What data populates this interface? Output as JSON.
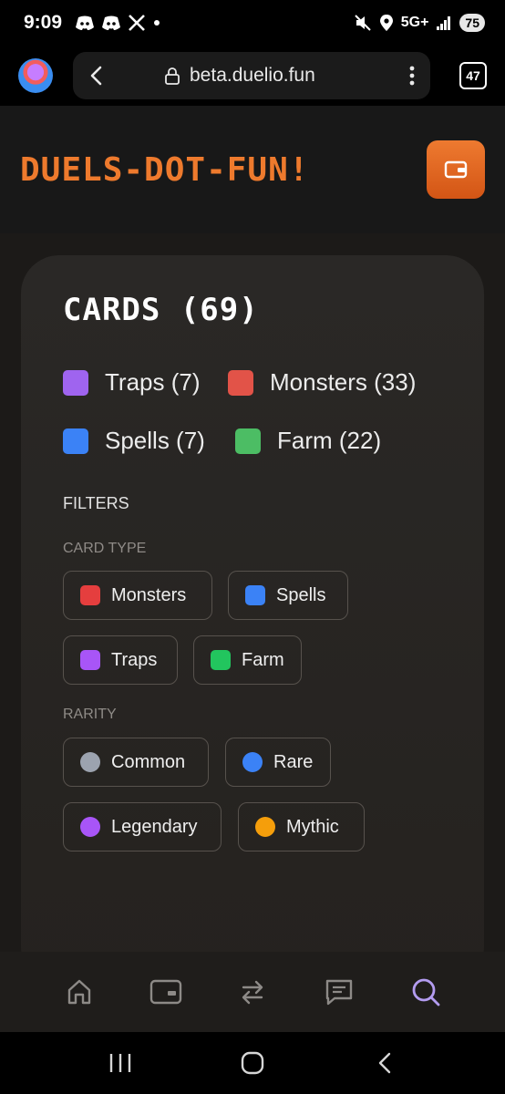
{
  "status_bar": {
    "time": "9:09",
    "network": "5G+",
    "battery": "75",
    "icons": [
      "discord-icon",
      "discord-icon",
      "x-icon",
      "dot-icon",
      "mute-icon",
      "location-icon",
      "signal-icon"
    ]
  },
  "browser": {
    "url": "beta.duelio.fun",
    "tab_count": "47"
  },
  "header": {
    "site_title": "DUELS-DOT-FUN!",
    "wallet_icon": "wallet-icon",
    "accent_color": "#e3631f"
  },
  "cards": {
    "title": "CARDS (69)",
    "counts": [
      {
        "label": "Traps (7)",
        "color": "#9f64ef"
      },
      {
        "label": "Monsters (33)",
        "color": "#e25348"
      },
      {
        "label": "Spells (7)",
        "color": "#3b82f6"
      },
      {
        "label": "Farm (22)",
        "color": "#4cbd64"
      }
    ]
  },
  "filters": {
    "heading": "FILTERS",
    "card_type_label": "CARD TYPE",
    "card_types": [
      {
        "label": "Monsters",
        "color": "#e53e3e"
      },
      {
        "label": "Spells",
        "color": "#3b82f6"
      },
      {
        "label": "Traps",
        "color": "#a855f7"
      },
      {
        "label": "Farm",
        "color": "#22c55e"
      }
    ],
    "rarity_label": "RARITY",
    "rarities": [
      {
        "label": "Common",
        "color": "#9ca3af"
      },
      {
        "label": "Rare",
        "color": "#3b82f6"
      },
      {
        "label": "Legendary",
        "color": "#a855f7"
      },
      {
        "label": "Mythic",
        "color": "#f59e0b"
      }
    ]
  },
  "bottom_nav": {
    "items": [
      "home-icon",
      "wallet-card-icon",
      "swap-icon",
      "chat-icon",
      "search-icon"
    ],
    "active": "search-icon",
    "active_color": "#b39cf0"
  },
  "system_nav": [
    "recents-icon",
    "home-circle-icon",
    "back-icon"
  ]
}
